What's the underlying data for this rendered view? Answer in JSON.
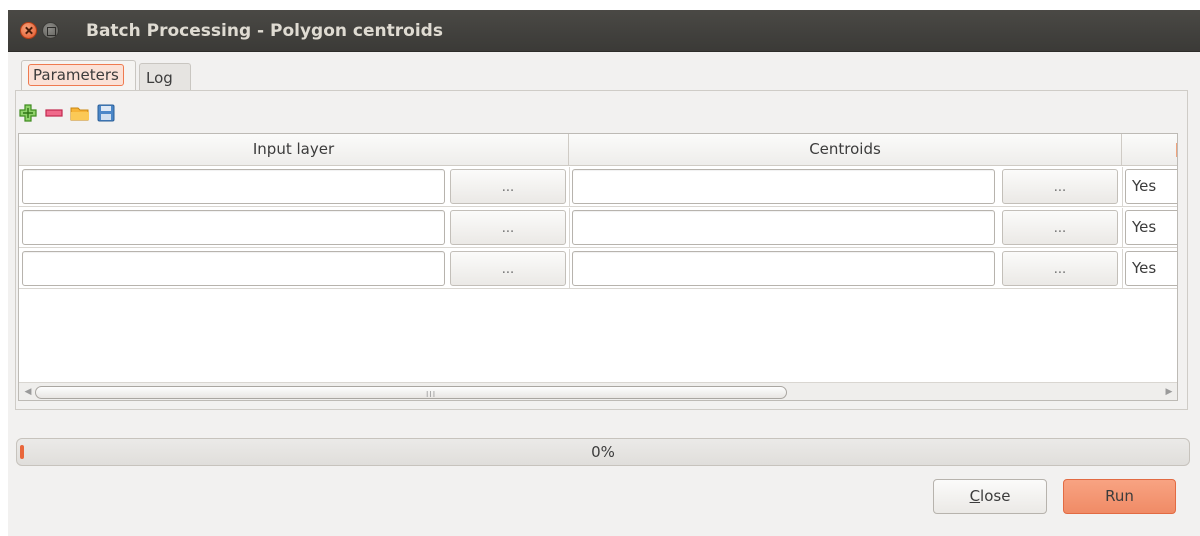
{
  "window": {
    "title": "Batch Processing - Polygon centroids"
  },
  "tabs": [
    {
      "label": "Parameters",
      "active": true
    },
    {
      "label": "Log",
      "active": false
    }
  ],
  "toolbar": {
    "icons": [
      "add-row-icon",
      "remove-row-icon",
      "open-folder-icon",
      "save-icon"
    ]
  },
  "table": {
    "columns": [
      "Input layer",
      "Centroids"
    ],
    "rows": [
      {
        "input_value": "",
        "browse_label": "...",
        "output_value": "",
        "output_browse_label": "...",
        "load_value": "Yes"
      },
      {
        "input_value": "",
        "browse_label": "...",
        "output_value": "",
        "output_browse_label": "...",
        "load_value": "Yes"
      },
      {
        "input_value": "",
        "browse_label": "...",
        "output_value": "",
        "output_browse_label": "...",
        "load_value": "Yes"
      }
    ],
    "scroll_grip": "III"
  },
  "progress": {
    "value": 0,
    "text": "0%"
  },
  "buttons": {
    "close_label": "Close",
    "run_label": "Run"
  },
  "colors": {
    "accent": "#f08b66",
    "titlebar": "#3b3a37"
  }
}
